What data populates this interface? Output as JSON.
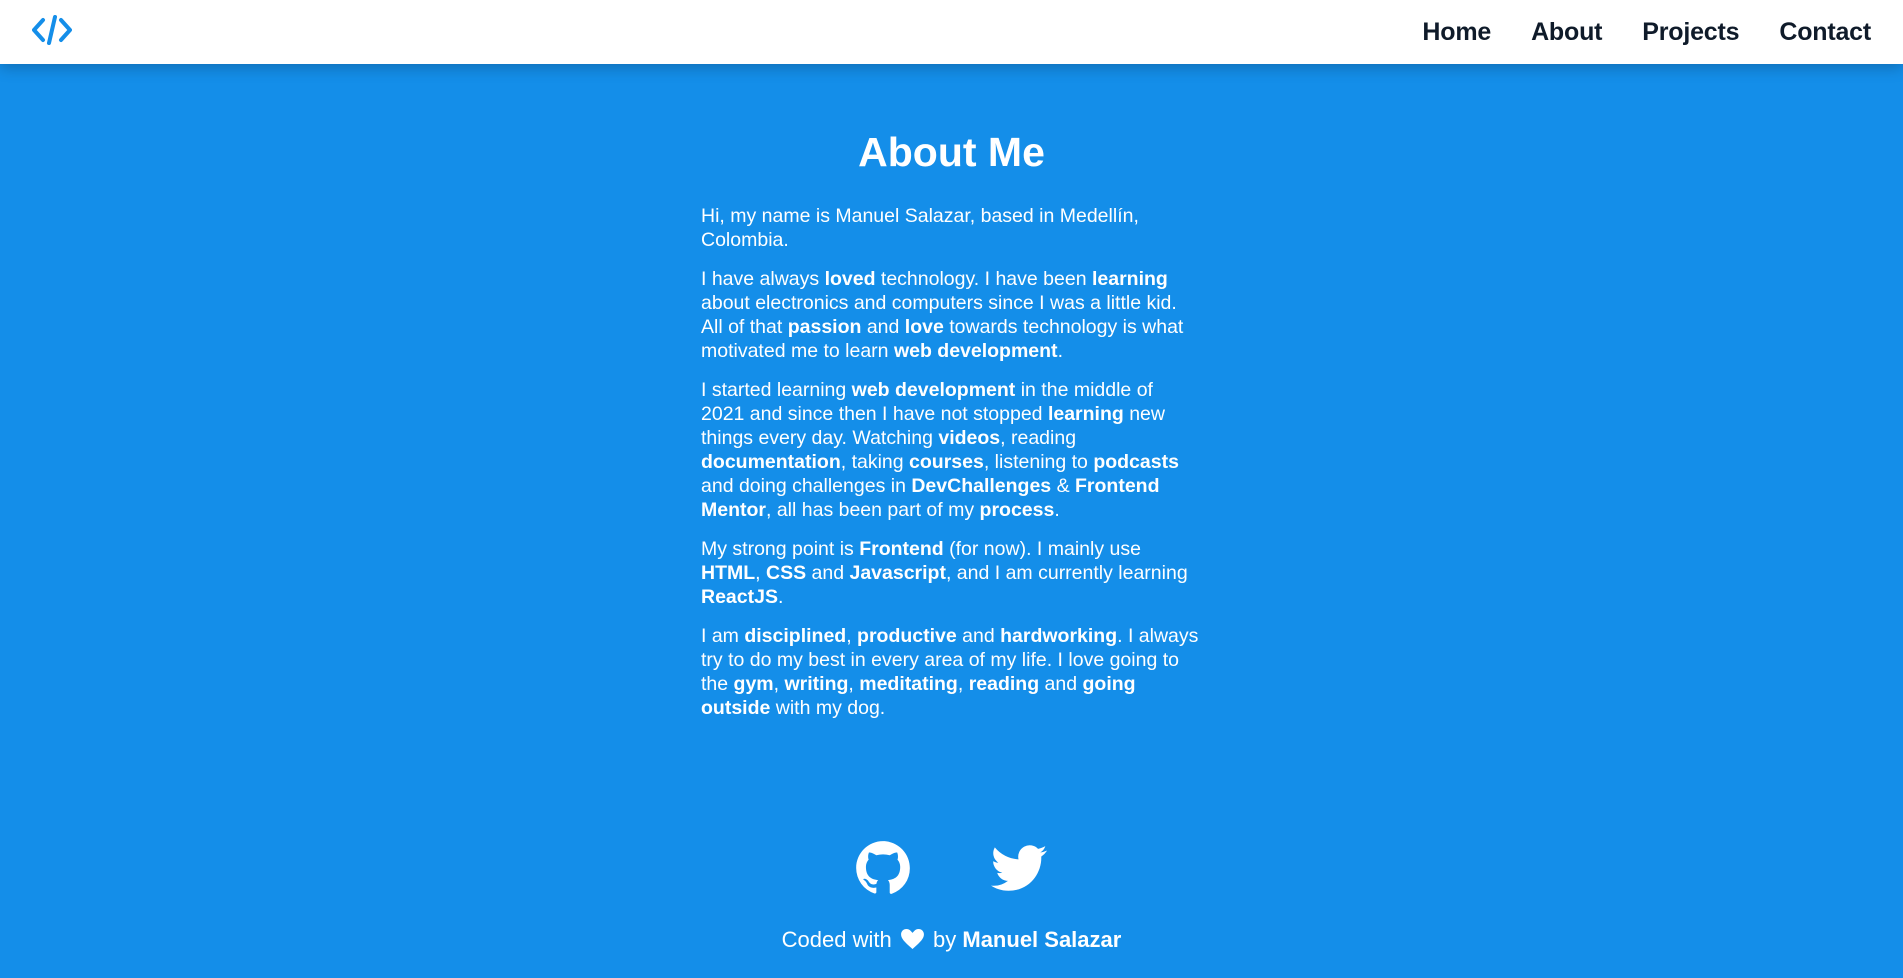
{
  "nav": {
    "logo_icon": "code-icon",
    "links": [
      "Home",
      "About",
      "Projects",
      "Contact"
    ]
  },
  "about": {
    "title": "About Me",
    "paragraphs": [
      [
        {
          "t": "Hi, my name is Manuel Salazar, based in Medellín, Colombia."
        }
      ],
      [
        {
          "t": "I have always "
        },
        {
          "t": "loved",
          "b": true
        },
        {
          "t": " technology. I have been "
        },
        {
          "t": "learning",
          "b": true
        },
        {
          "t": " about electronics and computers since I was a little kid. All of that "
        },
        {
          "t": "passion",
          "b": true
        },
        {
          "t": " and "
        },
        {
          "t": "love",
          "b": true
        },
        {
          "t": " towards technology is what motivated me to learn "
        },
        {
          "t": "web development",
          "b": true
        },
        {
          "t": "."
        }
      ],
      [
        {
          "t": "I started learning "
        },
        {
          "t": "web development",
          "b": true
        },
        {
          "t": " in the middle of 2021 and since then I have not stopped "
        },
        {
          "t": "learning",
          "b": true
        },
        {
          "t": " new things every day. Watching "
        },
        {
          "t": "videos",
          "b": true
        },
        {
          "t": ", reading "
        },
        {
          "t": "documentation",
          "b": true
        },
        {
          "t": ", taking "
        },
        {
          "t": "courses",
          "b": true
        },
        {
          "t": ", listening to "
        },
        {
          "t": "podcasts",
          "b": true
        },
        {
          "t": " and doing challenges in "
        },
        {
          "t": "DevChallenges",
          "b": true
        },
        {
          "t": " & "
        },
        {
          "t": "Frontend Mentor",
          "b": true
        },
        {
          "t": ", all has been part of my "
        },
        {
          "t": "process",
          "b": true
        },
        {
          "t": "."
        }
      ],
      [
        {
          "t": "My strong point is "
        },
        {
          "t": "Frontend",
          "b": true
        },
        {
          "t": " (for now). I mainly use "
        },
        {
          "t": "HTML",
          "b": true
        },
        {
          "t": ", "
        },
        {
          "t": "CSS",
          "b": true
        },
        {
          "t": " and "
        },
        {
          "t": "Javascript",
          "b": true
        },
        {
          "t": ", and I am currently learning "
        },
        {
          "t": "ReactJS",
          "b": true
        },
        {
          "t": "."
        }
      ],
      [
        {
          "t": "I am "
        },
        {
          "t": "disciplined",
          "b": true
        },
        {
          "t": ", "
        },
        {
          "t": "productive",
          "b": true
        },
        {
          "t": " and "
        },
        {
          "t": "hardworking",
          "b": true
        },
        {
          "t": ". I always try to do my best in every area of my life. I love going to the "
        },
        {
          "t": "gym",
          "b": true
        },
        {
          "t": ", "
        },
        {
          "t": "writing",
          "b": true
        },
        {
          "t": ", "
        },
        {
          "t": "meditating",
          "b": true
        },
        {
          "t": ", "
        },
        {
          "t": "reading",
          "b": true
        },
        {
          "t": " and "
        },
        {
          "t": "going outside",
          "b": true
        },
        {
          "t": " with my dog."
        }
      ]
    ]
  },
  "footer": {
    "icons": [
      "github-icon",
      "twitter-icon"
    ],
    "credit_prefix": "Coded with",
    "credit_icon": "heart-icon",
    "credit_by": "by",
    "credit_name": "Manuel Salazar"
  },
  "colors": {
    "background": "#148ee9",
    "navbar": "#ffffff",
    "nav_text": "#0f1b2a",
    "logo": "#148ee9",
    "text": "#ffffff"
  }
}
